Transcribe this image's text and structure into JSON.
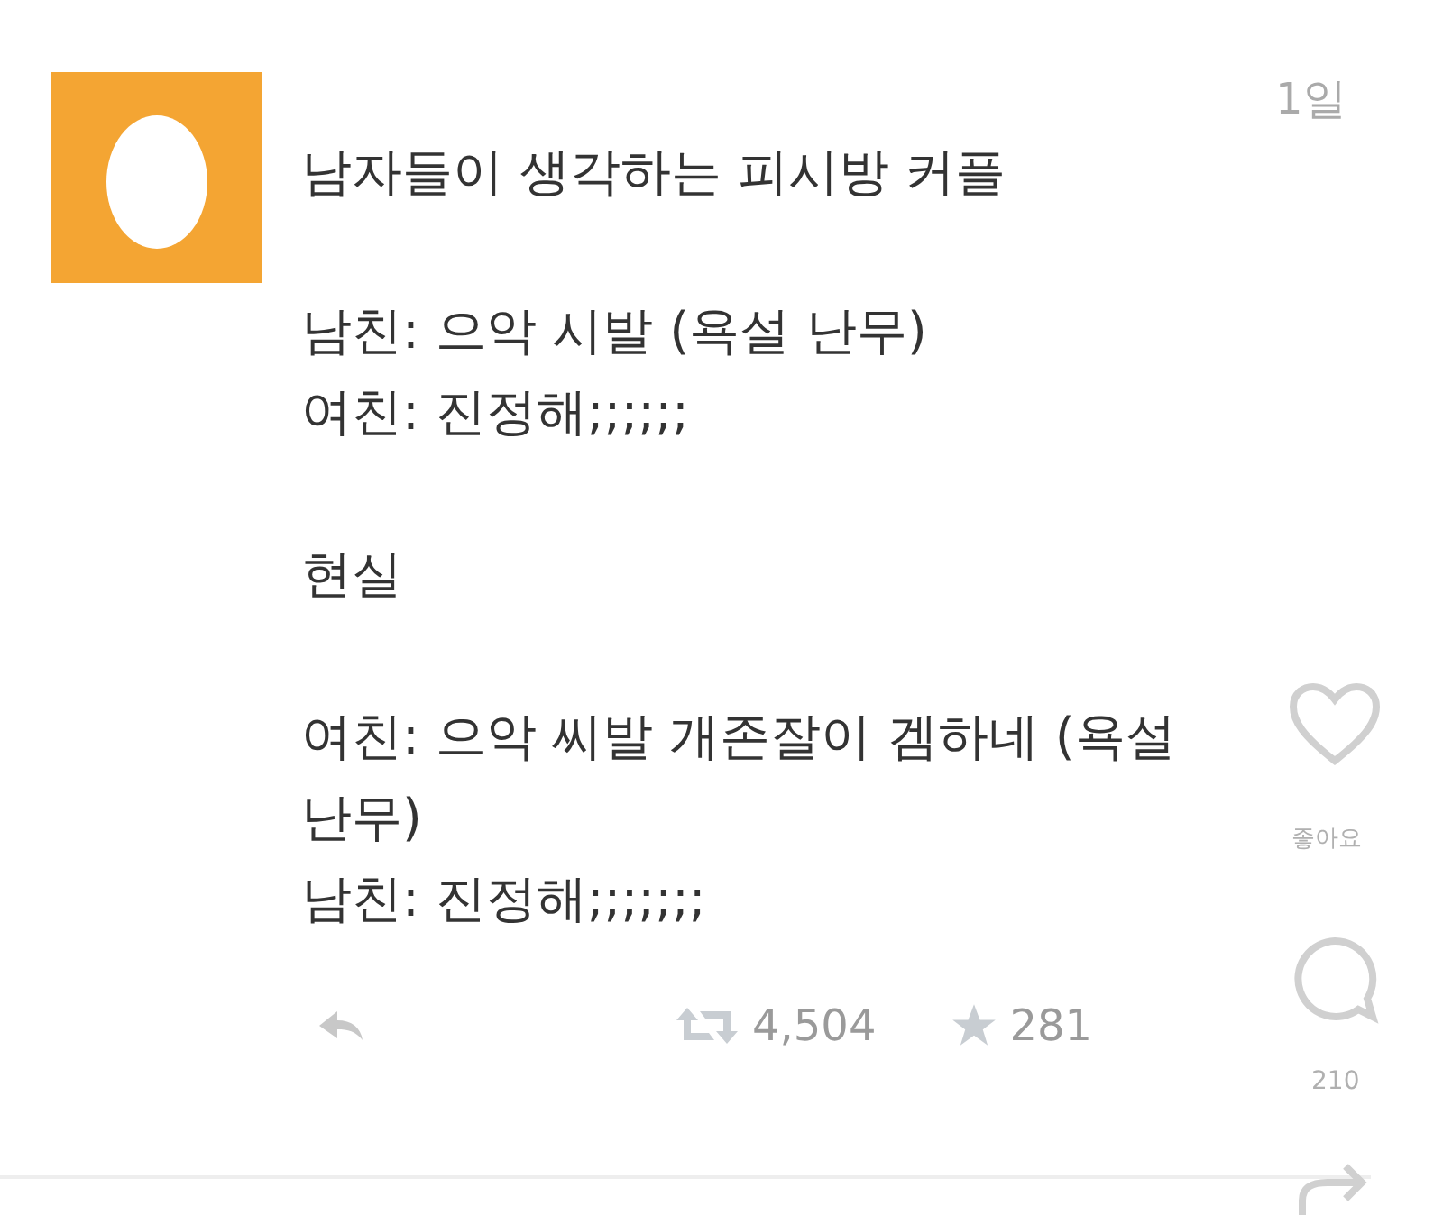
{
  "tweet": {
    "time": "1일",
    "title": "남자들이 생각하는 피시방 커플",
    "paragraphs": [
      [
        "남친: 으악 시발 (욕설 난무)",
        "여친: 진정해;;;;;;"
      ],
      [
        "현실"
      ],
      [
        "여친: 으악 씨발 개존잘이 겜하네 (욕설 난무)",
        "남친: 진정해;;;;;;;"
      ]
    ],
    "retweets": "4,504",
    "favorites": "281"
  },
  "overlay": {
    "like_label": "좋아요",
    "count": "210"
  }
}
